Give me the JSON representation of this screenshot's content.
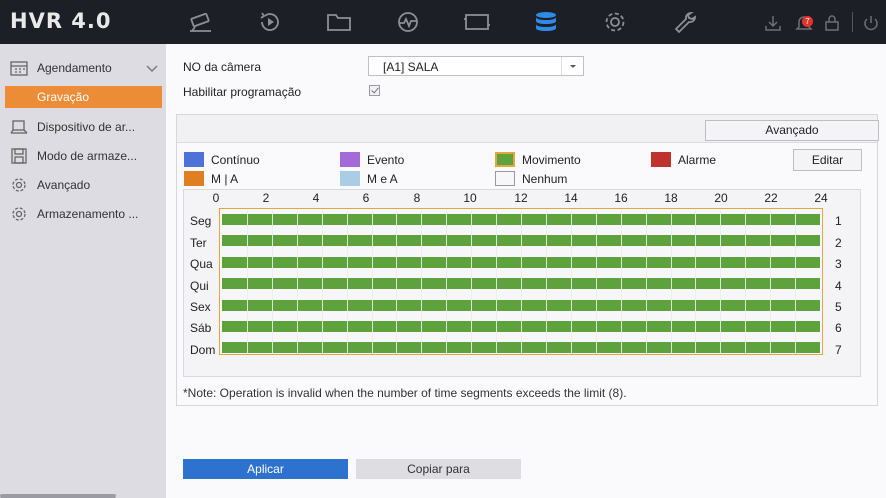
{
  "app": {
    "title": "HVR 4.0"
  },
  "topnav": {
    "icons": [
      "camera-icon",
      "playback-icon",
      "folder-icon",
      "analytics-icon",
      "display-icon",
      "storage-icon",
      "settings-icon",
      "maintenance-icon"
    ],
    "active_index": 5,
    "notification_count": "7"
  },
  "sidebar": {
    "header": "Agendamento",
    "sub_selected": "Gravação",
    "items": [
      {
        "icon": "hdd-icon",
        "label": "Dispositivo de ar..."
      },
      {
        "icon": "disk-save-icon",
        "label": "Modo de armaze..."
      },
      {
        "icon": "gear-icon",
        "label": "Avançado"
      },
      {
        "icon": "gear-icon",
        "label": "Armazenamento ..."
      }
    ]
  },
  "form": {
    "camera_label": "NO da câmera",
    "camera_value": "[A1] SALA",
    "schedule_label": "Habilitar programação",
    "schedule_enabled": true
  },
  "panel": {
    "advanced_button": "Avançado",
    "edit_button": "Editar",
    "legend": [
      {
        "label": "Contínuo",
        "color": "#4f72d8"
      },
      {
        "label": "Evento",
        "color": "#a46ad8"
      },
      {
        "label": "Movimento",
        "color": "#5ea23d"
      },
      {
        "label": "Alarme",
        "color": "#c0322d"
      },
      {
        "label": "M | A",
        "color": "#e07f22"
      },
      {
        "label": "M e A",
        "color": "#a9cde6"
      },
      {
        "label": "Nenhum",
        "color": "#f7f7f9"
      }
    ],
    "hours": [
      "0",
      "2",
      "4",
      "6",
      "8",
      "10",
      "12",
      "14",
      "16",
      "18",
      "20",
      "22",
      "24"
    ],
    "days": [
      {
        "label": "Seg",
        "num": "1"
      },
      {
        "label": "Ter",
        "num": "2"
      },
      {
        "label": "Qua",
        "num": "3"
      },
      {
        "label": "Qui",
        "num": "4"
      },
      {
        "label": "Sex",
        "num": "5"
      },
      {
        "label": "Sáb",
        "num": "6"
      },
      {
        "label": "Dom",
        "num": "7"
      }
    ],
    "schedule_type": "Movimento",
    "schedule_range": [
      "0:00",
      "24:00"
    ]
  },
  "note": "*Note: Operation is invalid when the number of time segments exceeds the limit (8).",
  "actions": {
    "apply": "Aplicar",
    "copy": "Copiar para"
  }
}
